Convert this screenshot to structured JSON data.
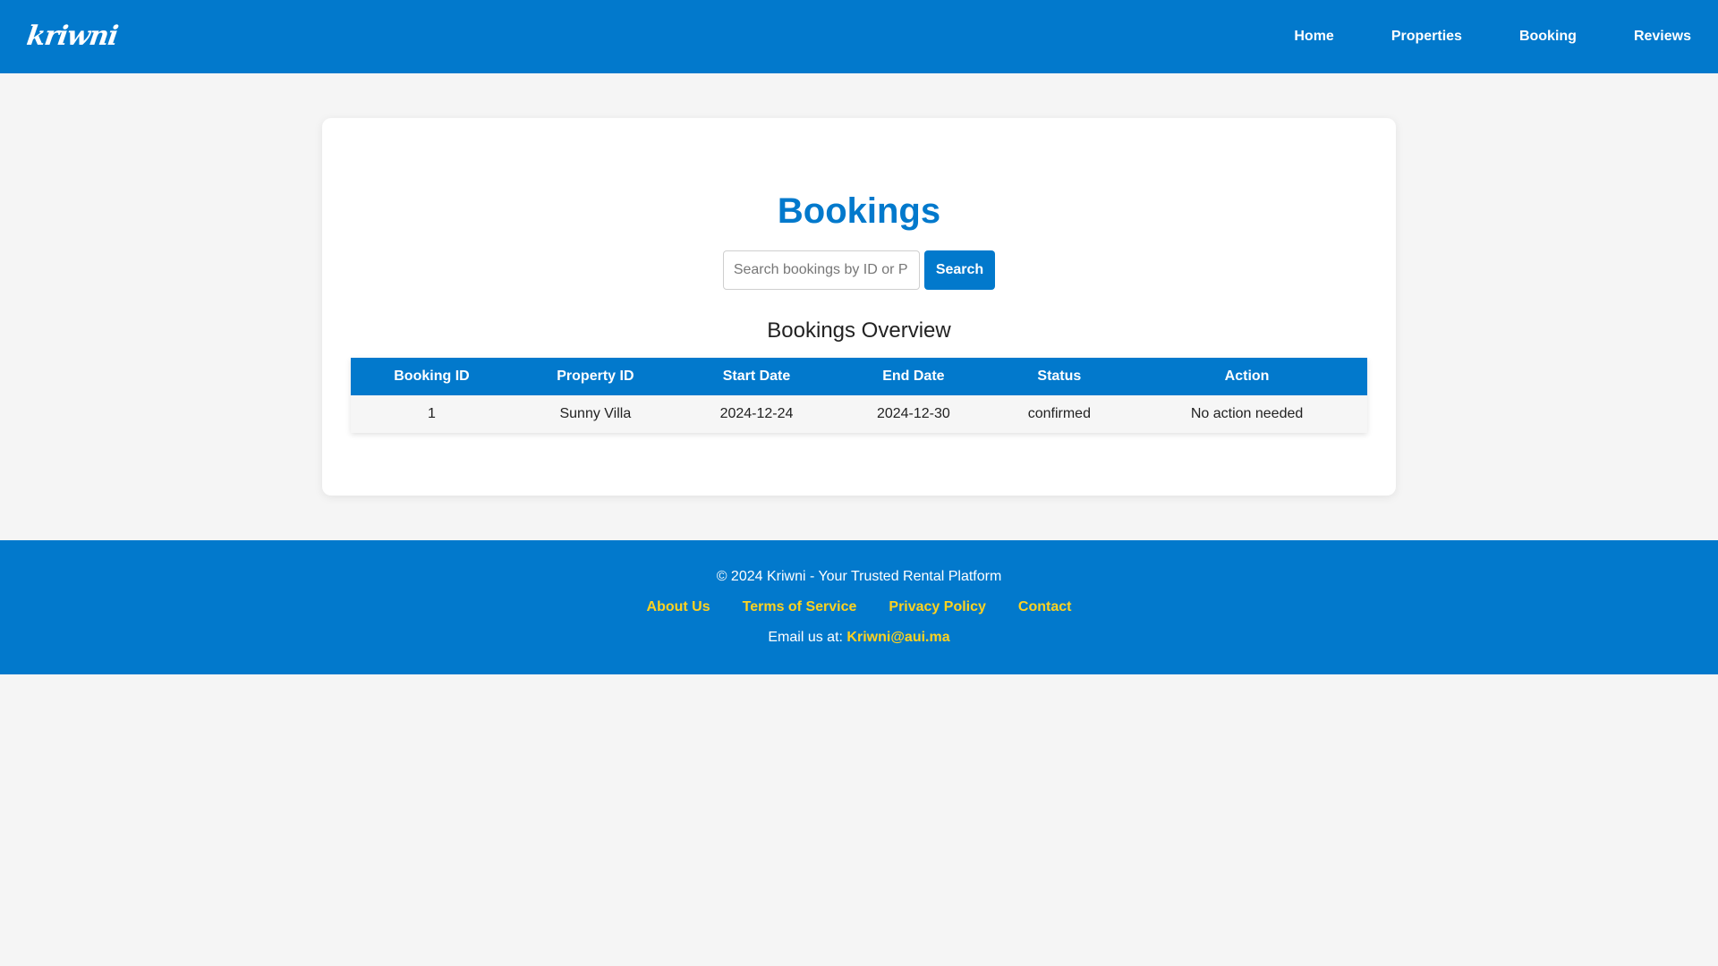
{
  "header": {
    "logo": "kriwni",
    "nav": [
      {
        "label": "Home"
      },
      {
        "label": "Properties"
      },
      {
        "label": "Booking"
      },
      {
        "label": "Reviews"
      }
    ]
  },
  "main": {
    "title": "Bookings",
    "search": {
      "placeholder": "Search bookings by ID or P",
      "value": "",
      "button_label": "Search"
    },
    "section_title": "Bookings Overview",
    "table": {
      "columns": [
        "Booking ID",
        "Property ID",
        "Start Date",
        "End Date",
        "Status",
        "Action"
      ],
      "rows": [
        [
          "1",
          "Sunny Villa",
          "2024-12-24",
          "2024-12-30",
          "confirmed",
          "No action needed"
        ]
      ]
    }
  },
  "footer": {
    "copyright": "© 2024 Kriwni - Your Trusted Rental Platform",
    "links": [
      {
        "label": "About Us"
      },
      {
        "label": "Terms of Service"
      },
      {
        "label": "Privacy Policy"
      },
      {
        "label": "Contact"
      }
    ],
    "email_prefix": "Email us at:",
    "email": "Kriwni@aui.ma"
  },
  "colors": {
    "primary": "#0279cc",
    "link_accent": "#ffd21f",
    "background": "#f5f5f5",
    "card": "#ffffff"
  }
}
